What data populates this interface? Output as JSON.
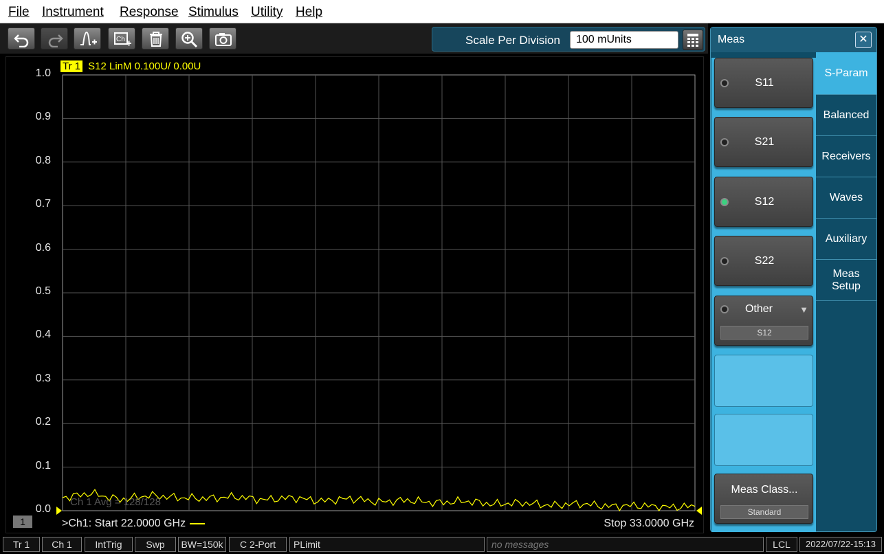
{
  "menu": [
    "File",
    "Instrument",
    "Response",
    "Stimulus",
    "Utility",
    "Help"
  ],
  "toolbar": {
    "icons": [
      "undo-icon",
      "redo-icon",
      "add-trace-icon",
      "add-channel-icon",
      "delete-icon",
      "zoom-icon",
      "camera-icon"
    ],
    "scale_label": "Scale Per Division",
    "scale_value": "100 mUnits"
  },
  "trace": {
    "badge": "Tr  1",
    "label": "S12 LinM 0.100U/  0.00U"
  },
  "chart_data": {
    "type": "line",
    "xlabel": "",
    "ylabel": "",
    "ylim": [
      0.0,
      1.0
    ],
    "xlim": [
      22.0,
      33.0
    ],
    "y_ticks": [
      "1.0",
      "0.9",
      "0.8",
      "0.7",
      "0.6",
      "0.5",
      "0.4",
      "0.3",
      "0.2",
      "0.1",
      "0.0"
    ],
    "grid": true,
    "series": [
      {
        "color": "#ffff00",
        "x": [
          22.0,
          22.5,
          23.0,
          23.5,
          24.0,
          24.5,
          25.0,
          25.5,
          26.0,
          26.5,
          27.0,
          27.5,
          28.0,
          28.5,
          29.0,
          29.5,
          30.0,
          30.5,
          31.0,
          31.5,
          32.0,
          32.5,
          33.0
        ],
        "values": [
          0.03,
          0.04,
          0.025,
          0.035,
          0.03,
          0.028,
          0.032,
          0.025,
          0.03,
          0.022,
          0.028,
          0.02,
          0.024,
          0.018,
          0.022,
          0.015,
          0.018,
          0.012,
          0.016,
          0.01,
          0.012,
          0.008,
          0.01
        ]
      }
    ],
    "avg_text": "Ch 1 Avg =   128/128",
    "channel_box": "1",
    "start_text": ">Ch1:  Start  22.0000 GHz",
    "stop_text": "Stop  33.0000 GHz"
  },
  "side_panel": {
    "title": "Meas",
    "buttons": [
      {
        "label": "S11",
        "selected": false
      },
      {
        "label": "S21",
        "selected": false
      },
      {
        "label": "S12",
        "selected": true
      },
      {
        "label": "S22",
        "selected": false
      }
    ],
    "other": {
      "label": "Other",
      "sub": "S12"
    },
    "meas_class": {
      "label": "Meas Class...",
      "sub": "Standard"
    },
    "tabs": [
      "S-Param",
      "Balanced",
      "Receivers",
      "Waves",
      "Auxiliary",
      "Meas Setup"
    ],
    "active_tab": "S-Param"
  },
  "status": {
    "items": [
      "Tr 1",
      "Ch 1",
      "IntTrig",
      "Swp",
      "BW=150k",
      "C  2-Port",
      "PLimit"
    ],
    "message": "no messages",
    "lcl": "LCL",
    "datetime": "2022/07/22-15:13"
  }
}
